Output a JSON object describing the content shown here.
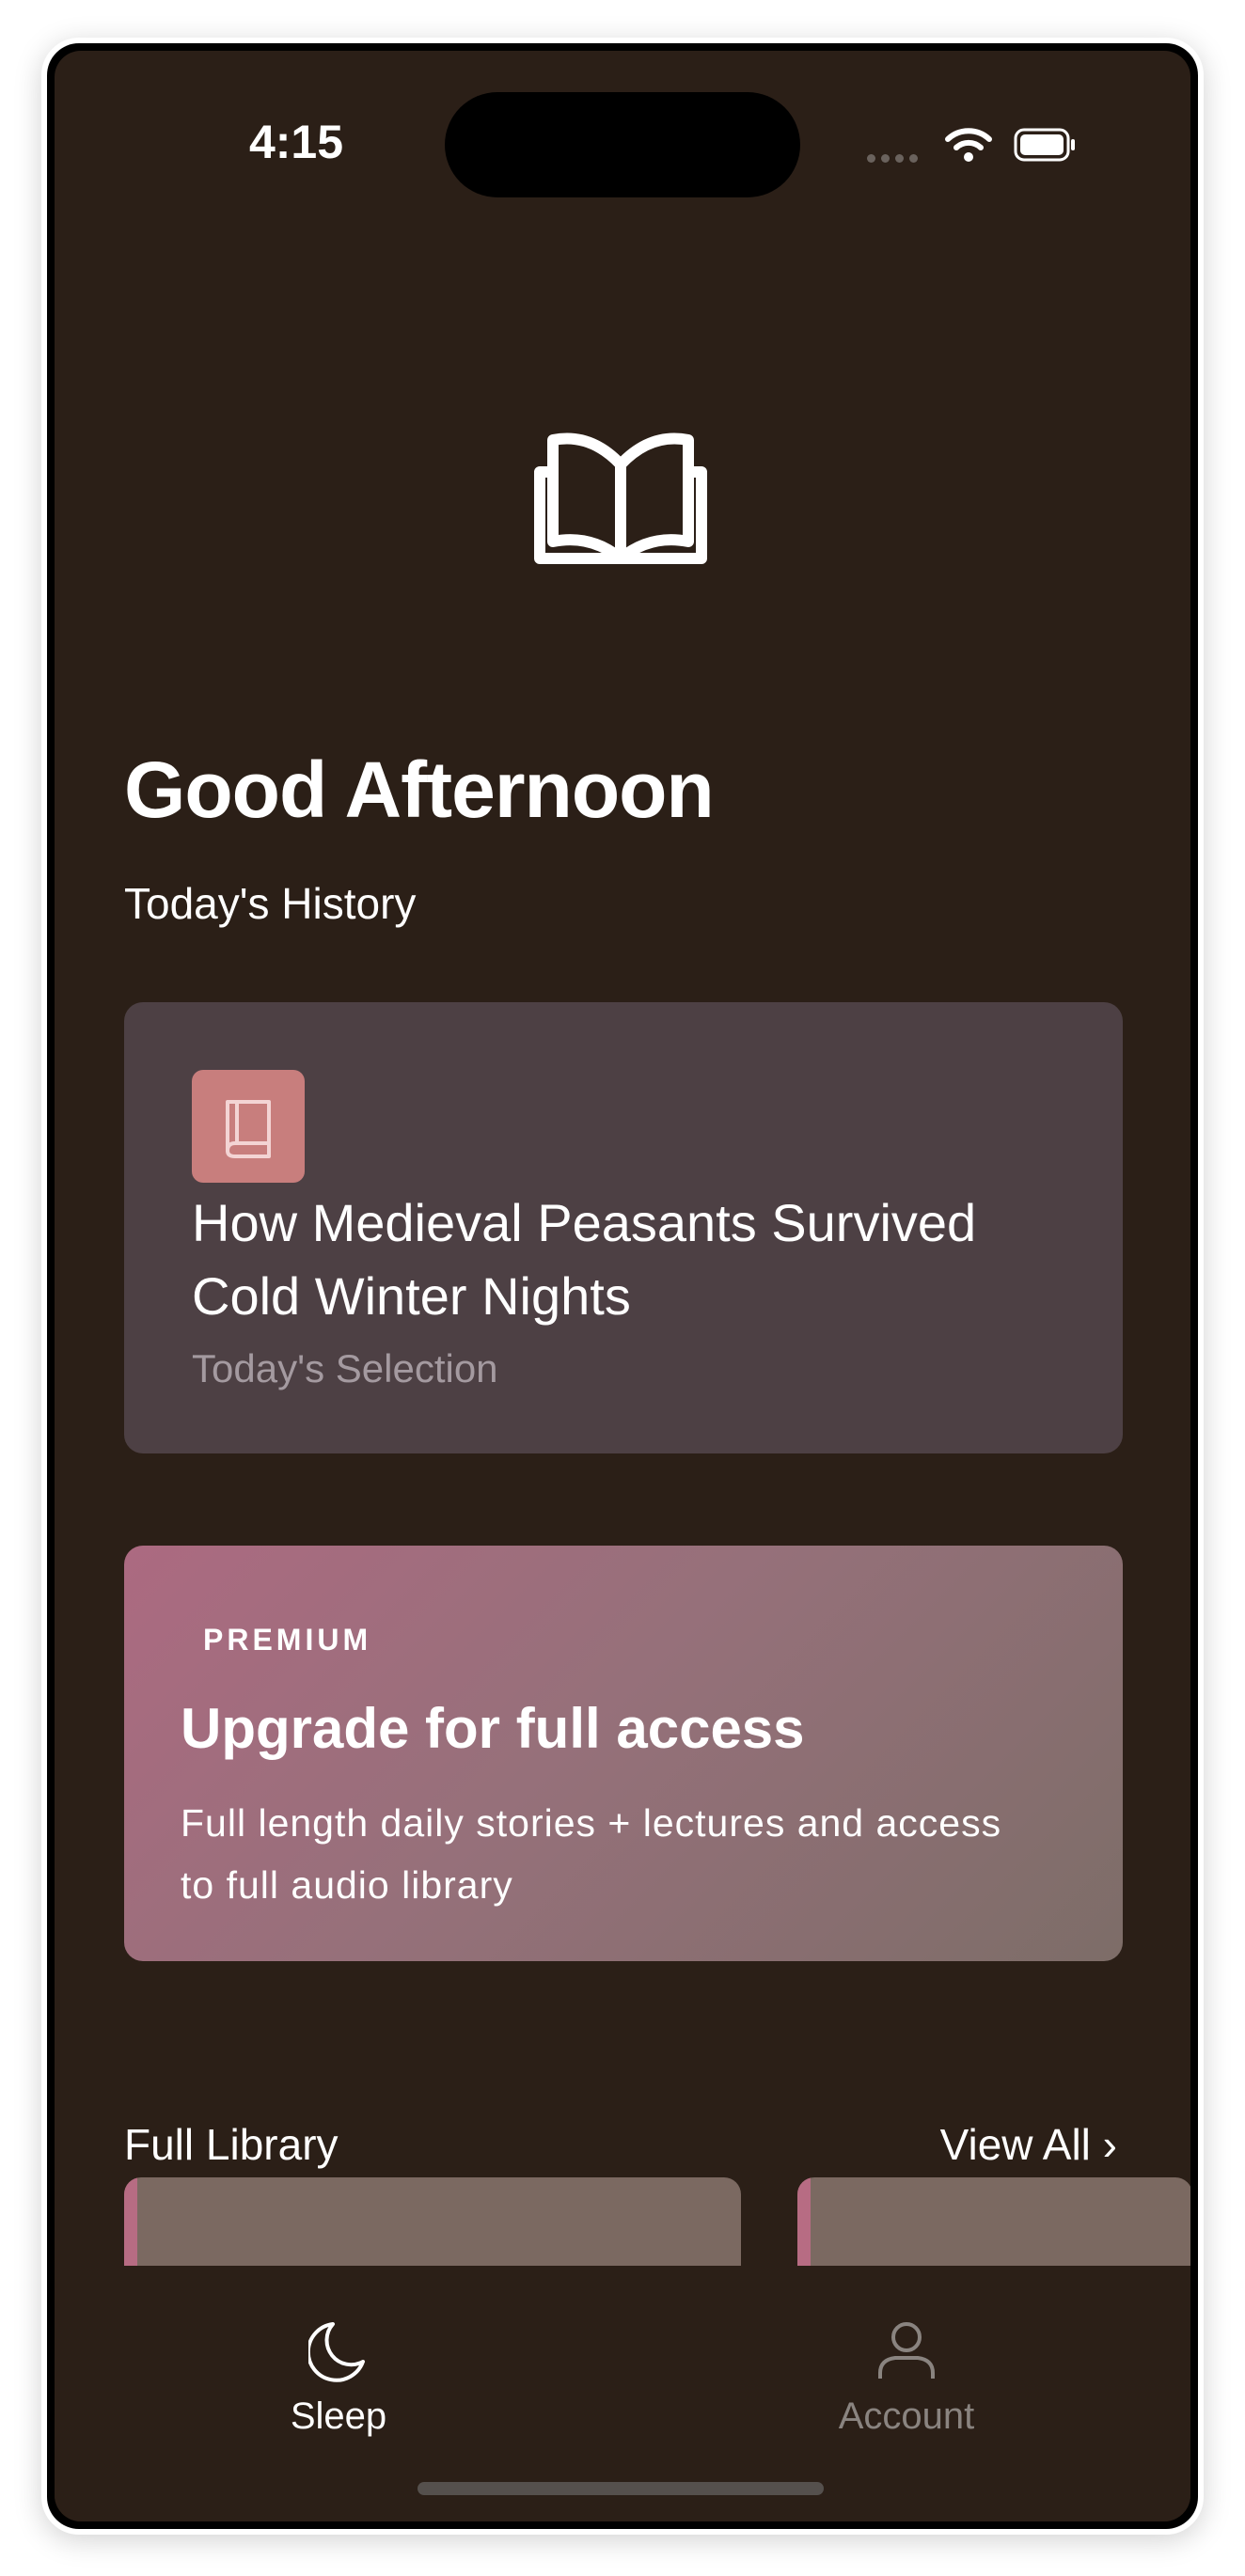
{
  "status_bar": {
    "time": "4:15",
    "icons": [
      "cellular-dots-icon",
      "wifi-icon",
      "battery-icon"
    ]
  },
  "hero": {
    "icon": "open-book-icon"
  },
  "greeting": "Good Afternoon",
  "history": {
    "label": "Today's History",
    "card": {
      "icon": "book-icon",
      "title": "How Medieval Peasants Survived Cold Winter Nights",
      "subtitle": "Today's Selection"
    }
  },
  "premium": {
    "tag": "PREMIUM",
    "title": "Upgrade for full access",
    "description": "Full length daily stories + lectures and access to full audio library"
  },
  "library": {
    "label": "Full Library",
    "view_all": "View All ›"
  },
  "tabs": [
    {
      "label": "Sleep",
      "icon": "moon-icon",
      "active": true
    },
    {
      "label": "Account",
      "icon": "person-icon",
      "active": false
    }
  ],
  "colors": {
    "background": "#2b1f17",
    "card": "#4d4044",
    "thumb": "#c87e7d",
    "premium_start": "#ac6a81",
    "premium_end": "#7d6d68",
    "library_card": "#7b6961",
    "library_accent": "#b76c83"
  }
}
